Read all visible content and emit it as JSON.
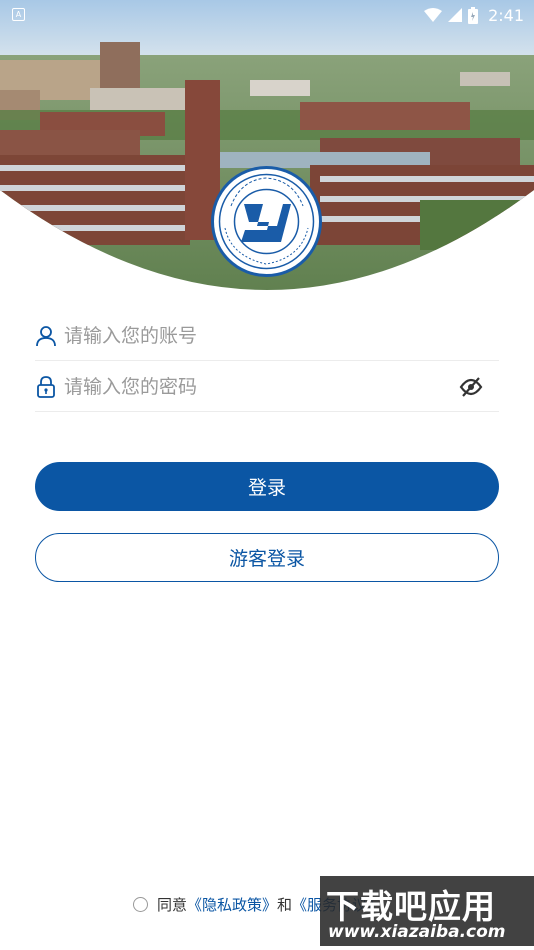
{
  "status_bar": {
    "notification_icon": "a-notification-icon",
    "notification_letter": "A",
    "icons": [
      "wifi-icon",
      "cell-signal-icon",
      "battery-icon"
    ],
    "time": "2:41"
  },
  "header": {
    "image": "campus-photo",
    "logo": "college-seal-logo"
  },
  "login_form": {
    "account": {
      "icon": "user-icon",
      "placeholder": "请输入您的账号",
      "value": ""
    },
    "password": {
      "icon": "lock-icon",
      "placeholder": "请输入您的密码",
      "value": "",
      "toggle_icon": "eye-off-icon"
    },
    "login_label": "登录",
    "guest_label": "游客登录"
  },
  "agreement": {
    "prefix": "同意",
    "privacy_link": "《隐私政策》",
    "conjunction": "和",
    "service_link": "《服务协议》"
  },
  "watermark": {
    "line1": "下载吧应用",
    "line2": "www.xiazaiba.com"
  },
  "colors": {
    "brand": "#0b56a4",
    "placeholder": "#9a9a9a",
    "divider": "#ececec"
  }
}
